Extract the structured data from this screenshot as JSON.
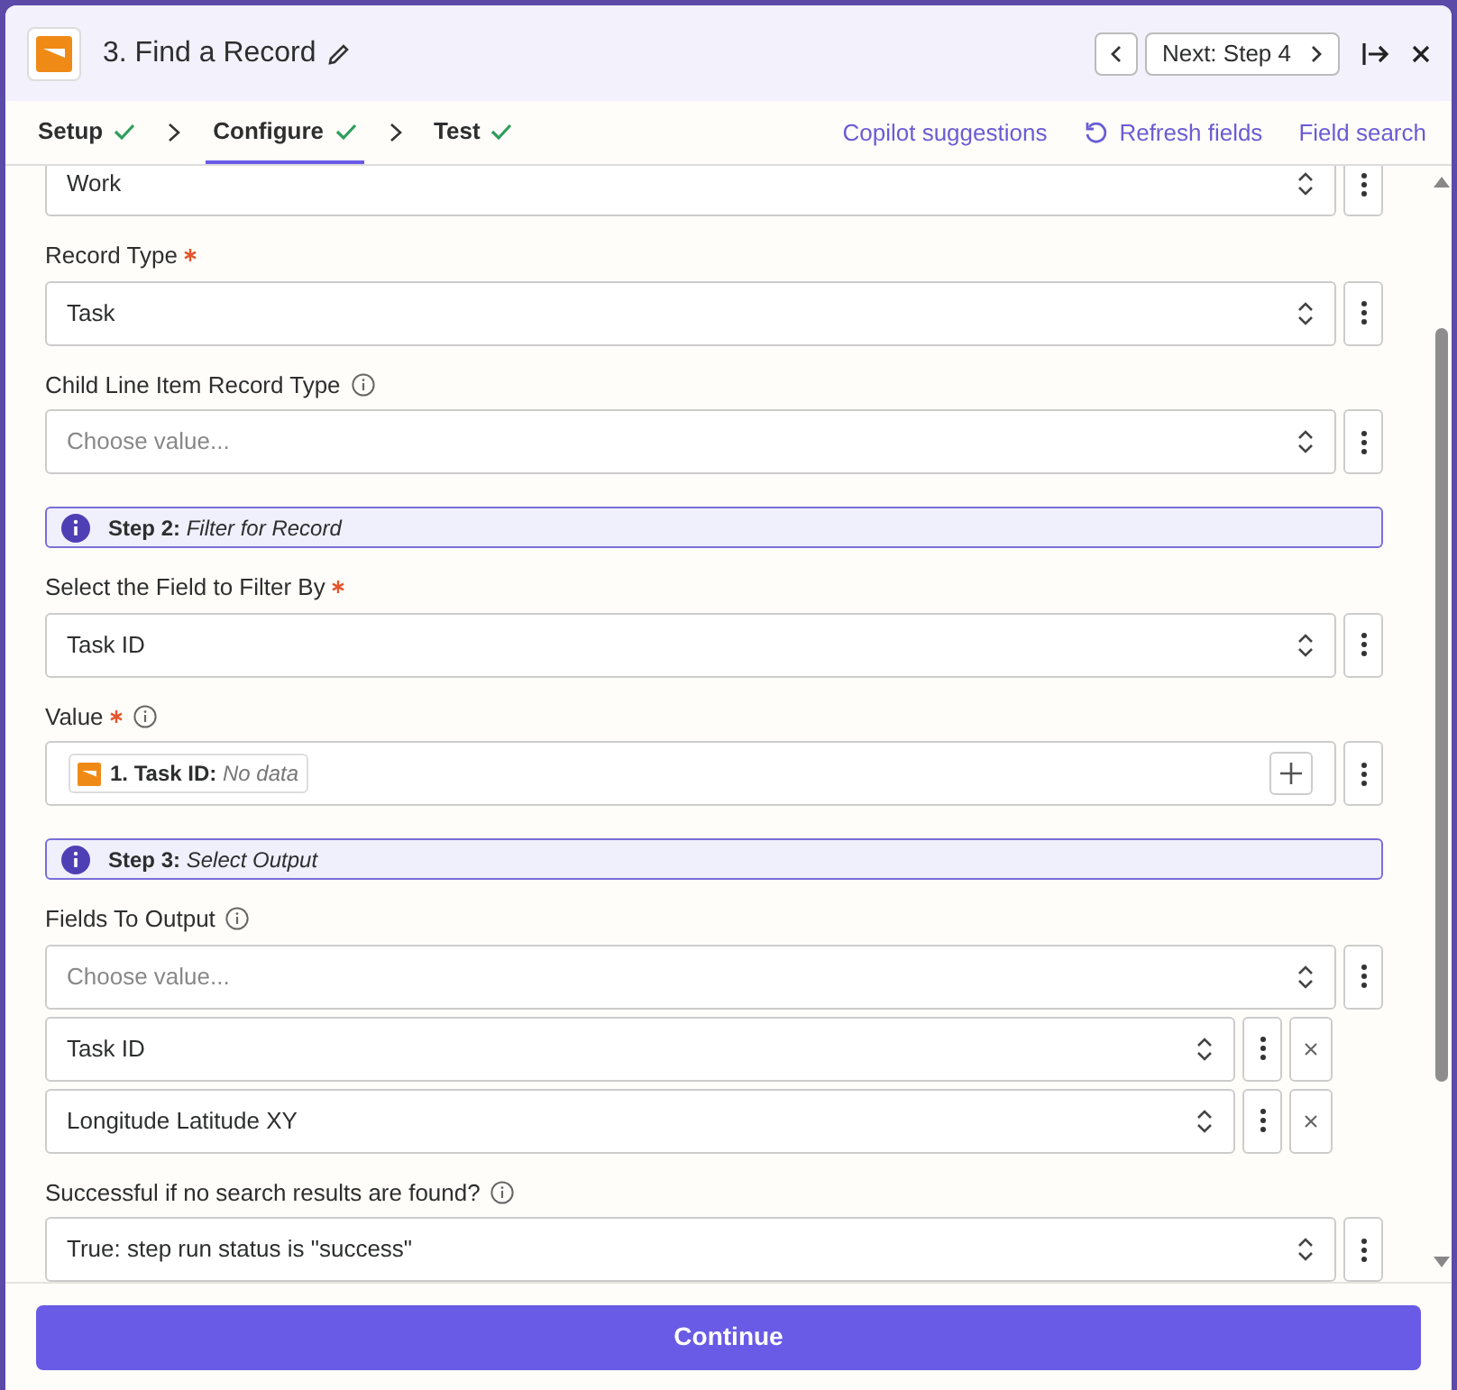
{
  "header": {
    "title": "3. Find a Record",
    "next_button": "Next: Step 4"
  },
  "tabs": [
    {
      "label": "Setup",
      "complete": true,
      "selected": false
    },
    {
      "label": "Configure",
      "complete": true,
      "selected": true
    },
    {
      "label": "Test",
      "complete": true,
      "selected": false
    }
  ],
  "actions": [
    "Copilot suggestions",
    "Refresh fields",
    "Field search"
  ],
  "fields": [
    {
      "kind": "select",
      "value": "Work"
    },
    {
      "kind": "select",
      "label": "Record Type",
      "required": true,
      "info": false,
      "value": "Task"
    },
    {
      "kind": "select",
      "label": "Child Line Item Record Type",
      "required": false,
      "info": true,
      "placeholder": "Choose value..."
    },
    {
      "kind": "note",
      "step": "Step 2:",
      "text": "Filter for Record"
    },
    {
      "kind": "select",
      "label": "Select the Field to Filter By",
      "required": true,
      "info": false,
      "value": "Task ID"
    },
    {
      "kind": "token",
      "label": "Value",
      "required": true,
      "info": true,
      "token_label": "1. Task ID:",
      "token_value": "No data"
    },
    {
      "kind": "note",
      "step": "Step 3:",
      "text": "Select Output"
    },
    {
      "kind": "multi",
      "label": "Fields To Output",
      "required": false,
      "info": true,
      "placeholder": "Choose value...",
      "items": [
        "Task ID",
        "Longitude Latitude XY"
      ]
    },
    {
      "kind": "select",
      "label": "Successful if no search results are found?",
      "required": false,
      "info": true,
      "value": "True: step run status is \"success\""
    }
  ],
  "footer": {
    "button": "Continue"
  }
}
